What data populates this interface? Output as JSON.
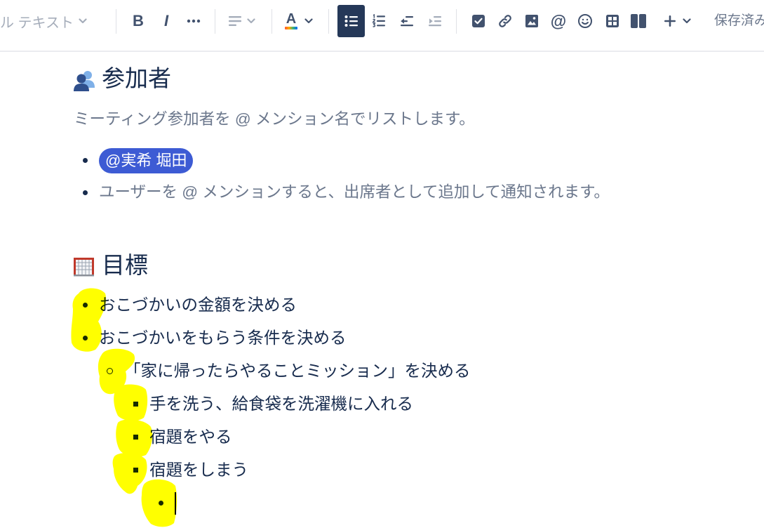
{
  "toolbar": {
    "text_style": {
      "label": "ル テキスト",
      "icon": "chevron-down-icon"
    },
    "bold": {
      "glyph": "B",
      "icon": "bold-icon"
    },
    "italic": {
      "glyph": "I",
      "icon": "italic-icon"
    },
    "more_formatting": {
      "icon": "more-icon"
    },
    "alignment": {
      "icon": "align-left-icon",
      "disabled": true
    },
    "text_color": {
      "glyph": "A",
      "icon": "text-color-icon",
      "bar_colors": [
        "#ff5630",
        "#ffab00",
        "#36b37e",
        "#0065ff"
      ]
    },
    "bullet_list": {
      "icon": "bullet-list-icon",
      "active": true
    },
    "numbered_list": {
      "icon": "numbered-list-icon"
    },
    "outdent": {
      "icon": "outdent-icon"
    },
    "indent": {
      "icon": "indent-icon",
      "disabled": true
    },
    "action_item": {
      "icon": "checkbox-icon"
    },
    "link": {
      "icon": "link-icon"
    },
    "image": {
      "icon": "image-icon"
    },
    "mention": {
      "glyph": "@",
      "icon": "mention-icon"
    },
    "emoji": {
      "icon": "emoji-icon"
    },
    "table": {
      "icon": "table-icon"
    },
    "layout": {
      "icon": "layout-columns-icon"
    },
    "insert": {
      "icon": "plus-icon"
    },
    "save_status": "保存済み"
  },
  "sections": {
    "attendees": {
      "icon": "busts-in-silhouette-icon",
      "heading": "参加者",
      "description": "ミーティング参加者を @ メンション名でリストします。",
      "items": [
        {
          "type": "mention",
          "text": "@実希 堀田"
        },
        {
          "type": "placeholder",
          "text": "ユーザーを @ メンションすると、出席者として追加して通知されます。"
        }
      ]
    },
    "goals": {
      "icon": "goal-net-icon",
      "heading": "目標",
      "items": [
        {
          "text": "おこづかいの金額を決める"
        },
        {
          "text": "おこづかいをもらう条件を決める",
          "children": [
            {
              "text": "「家に帰ったらやることミッション」を決める",
              "children": [
                {
                  "text": "手を洗う、給食袋を洗濯機に入れる"
                },
                {
                  "text": "宿題をやる"
                },
                {
                  "text": "宿題をしまう",
                  "children": [
                    {
                      "text": "",
                      "has_cursor": true
                    }
                  ]
                }
              ]
            }
          ]
        }
      ]
    }
  },
  "colors": {
    "text_primary": "#172b4d",
    "text_subtle": "#6b778c",
    "toolbar_icon": "#42526e",
    "toolbar_icon_disabled": "#a5adba",
    "active_button_bg": "#253858",
    "mention_bg": "#3d5bd4",
    "mention_text": "#ffffff",
    "highlighter": "#ffff00"
  }
}
